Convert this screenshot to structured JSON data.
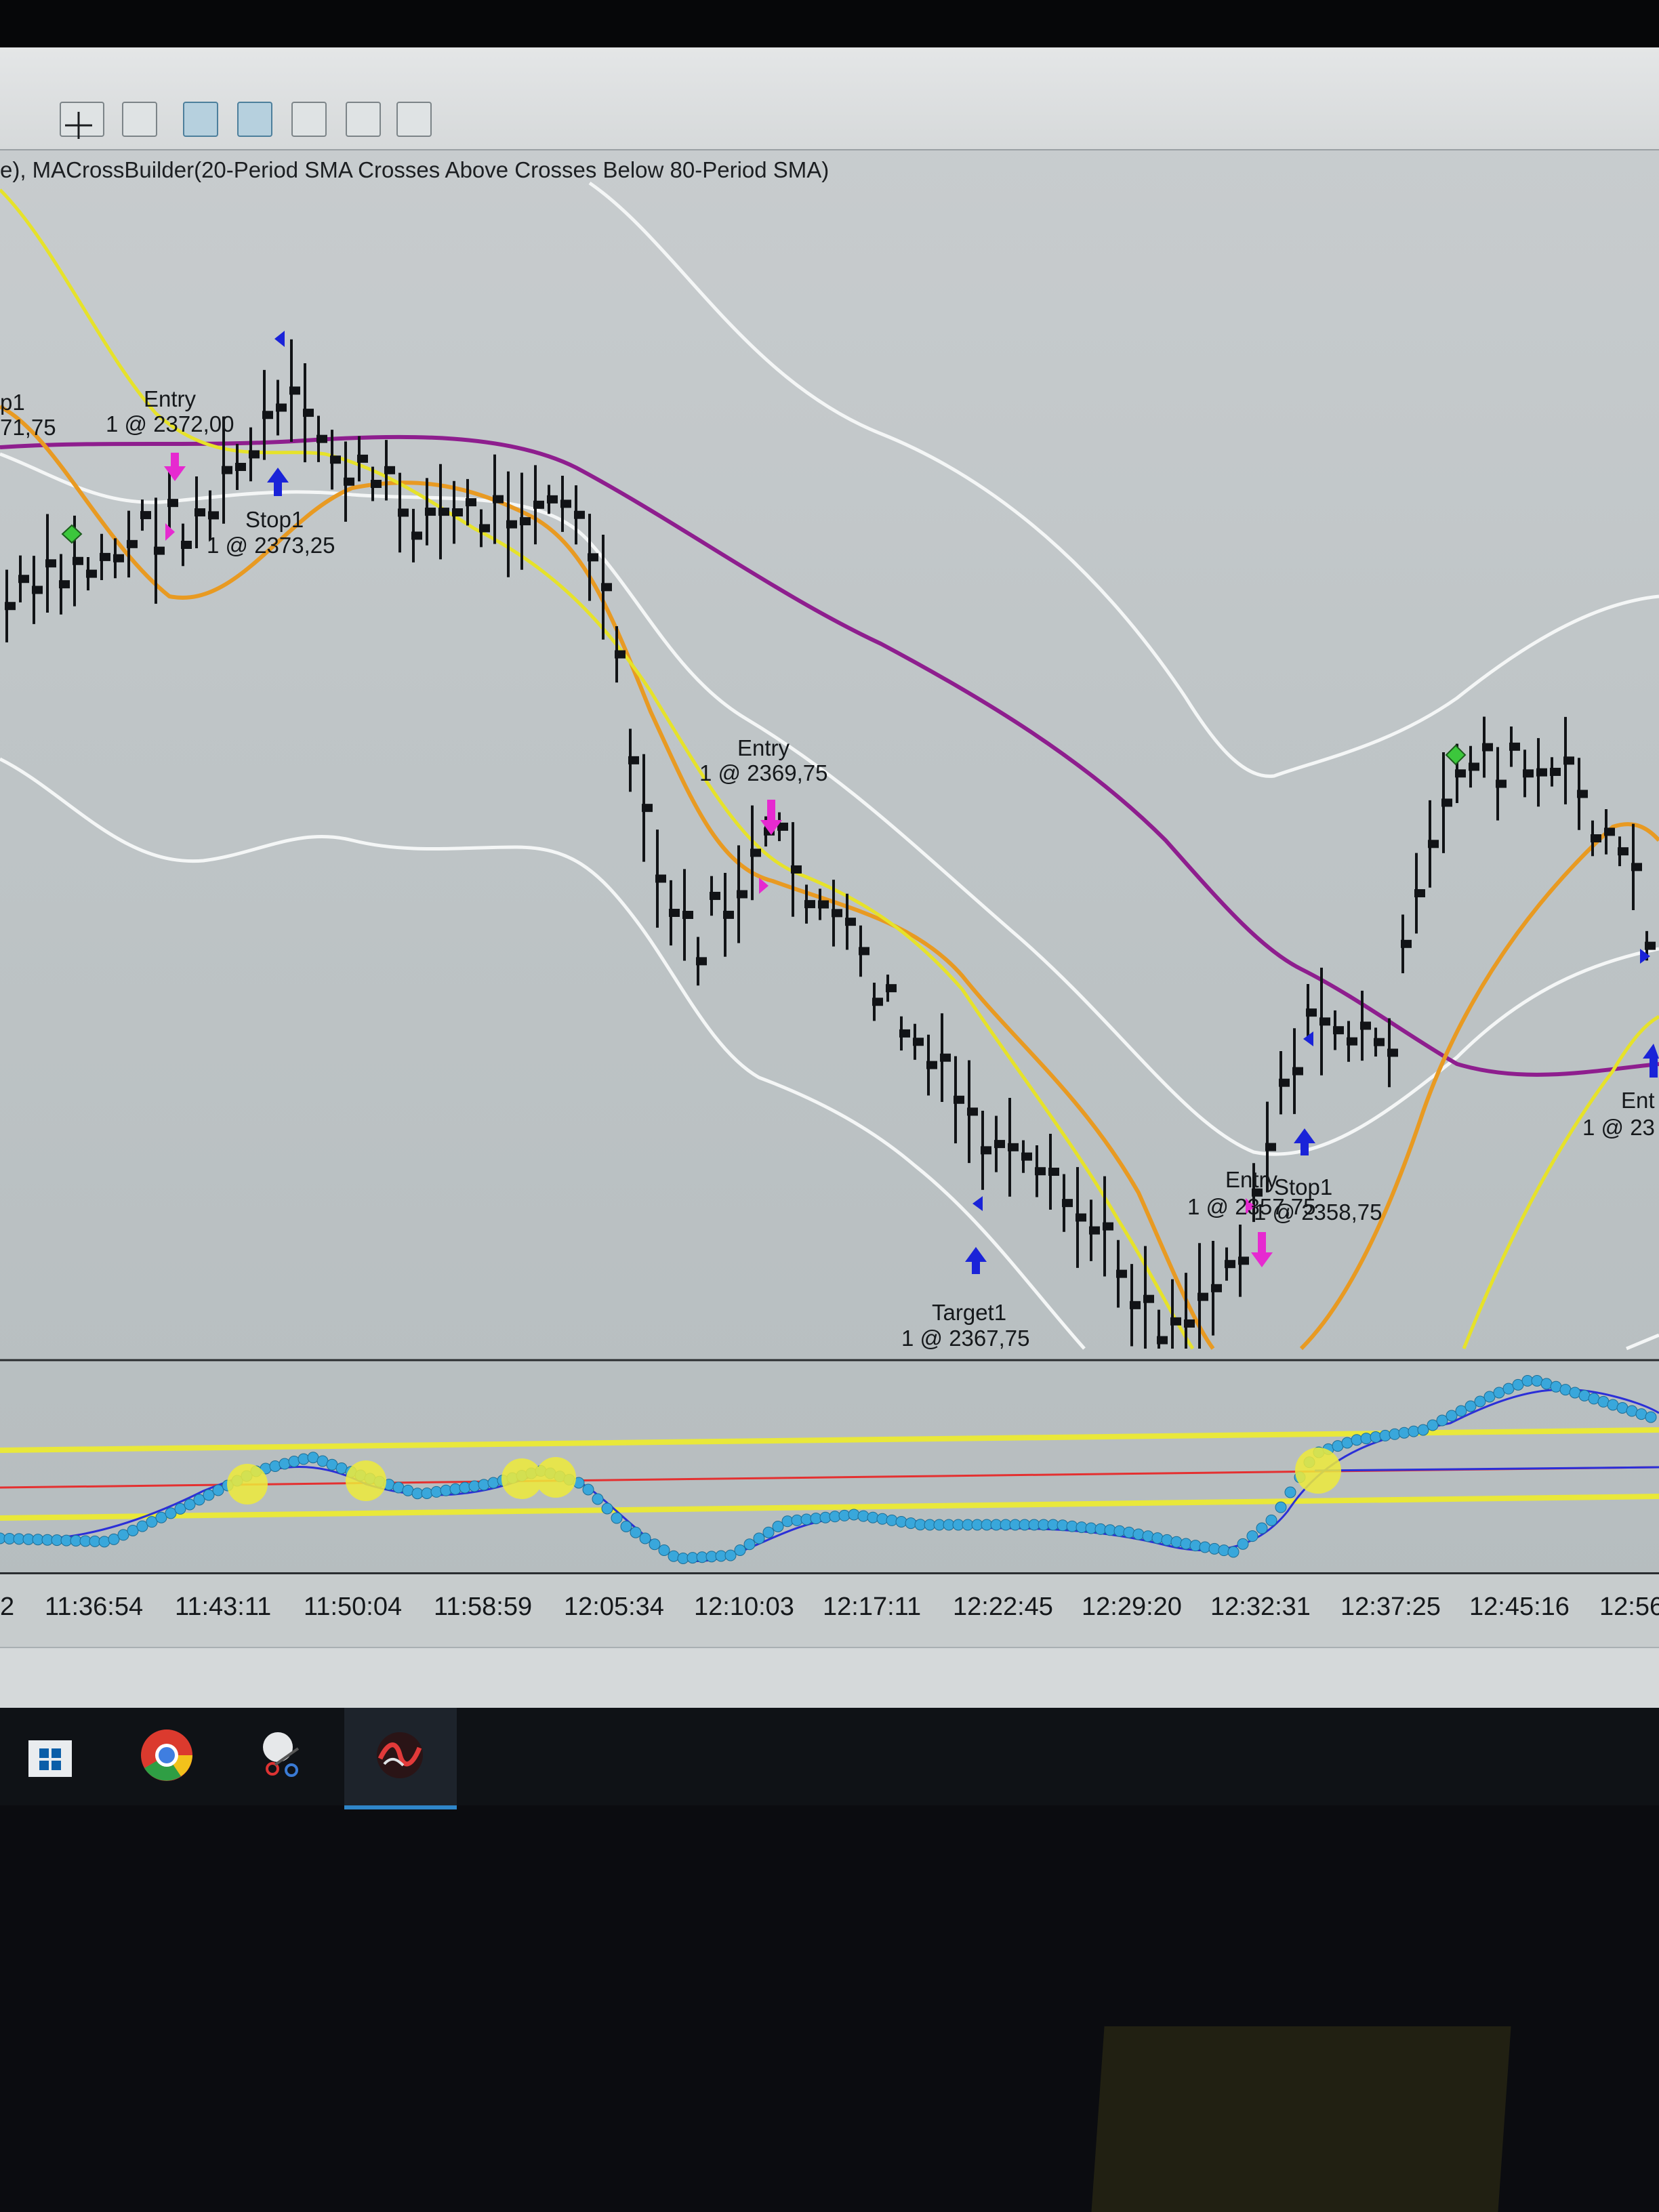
{
  "chart": {
    "strategy_caption": "e), MACrossBuilder(20-Period SMA Crosses Above  Crosses Below 80-Period SMA)"
  },
  "markers": [
    {
      "title": "p1",
      "detail": "71,75"
    },
    {
      "title": "Entry",
      "detail": "1 @ 2372,00"
    },
    {
      "title": "Stop1",
      "detail": "1 @ 2373,25"
    },
    {
      "title": "Entry",
      "detail": "1 @ 2369,75"
    },
    {
      "title": "Target1",
      "detail": "1 @ 2367,75"
    },
    {
      "title": "Entry",
      "detail": "1 @ 2357,75"
    },
    {
      "title": "Stop1",
      "detail": "1 @ 2358,75"
    },
    {
      "title": "Ent",
      "detail": "1 @ 23"
    }
  ],
  "time_axis": [
    "2",
    "11:36:54",
    "11:43:11",
    "11:50:04",
    "11:58:59",
    "12:05:34",
    "12:10:03",
    "12:17:11",
    "12:22:45",
    "12:29:20",
    "12:32:31",
    "12:37:25",
    "12:45:16",
    "12:56"
  ],
  "toolbar_icons": [
    "crosshair-icon",
    "zoom-icon",
    "bar-style-icon",
    "candlestick-icon",
    "line-chart-icon",
    "dollar-icon",
    "panel-icon"
  ],
  "taskbar_icons": [
    "store-icon",
    "chrome-icon",
    "snipping-tool-icon",
    "trading-platform-icon"
  ],
  "colors": {
    "sma20": "#e6e22a",
    "sma_orange": "#e89a22",
    "sma80": "#8e1e8e",
    "bands": "#f4f6f6",
    "buy_arrow": "#1a23d8",
    "sell_arrow": "#e62ad0",
    "oscillator_dots": "#39a7db",
    "oscillator_levels": "#e9e83a"
  }
}
